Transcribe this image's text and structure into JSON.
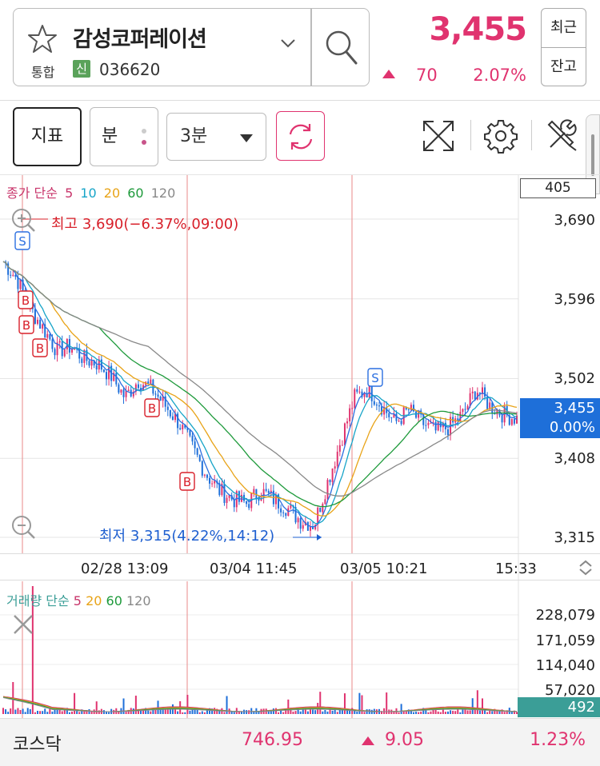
{
  "header": {
    "stock_name": "감성코퍼레이션",
    "market": "통합",
    "new_badge": "신",
    "code": "036620",
    "price": "3,455",
    "change": "70",
    "change_pct": "2.07%",
    "side_buttons": [
      "최근",
      "잔고"
    ]
  },
  "toolbar": {
    "indicator_label": "지표",
    "unit_label": "분",
    "interval_value": "3분",
    "icons": [
      "refresh-icon",
      "fullscreen-icon",
      "settings-icon",
      "tools-icon"
    ]
  },
  "price_chart": {
    "legend": {
      "prefix": "종가 단순",
      "ma": [
        "5",
        "10",
        "20",
        "60",
        "120"
      ]
    },
    "volume_box": "405",
    "y_axis": [
      "3,690",
      "3,596",
      "3,502",
      "3,408",
      "3,315"
    ],
    "current_price": "3,455",
    "current_pct": "0.00%",
    "high_label": "최고 3,690(−6.37%,09:00)",
    "low_label": "최저 3,315(4.22%,14:12)",
    "signals": [
      "S",
      "B",
      "B",
      "B",
      "B",
      "B",
      "S"
    ]
  },
  "time_axis": [
    "02/28 13:09",
    "03/04 11:45",
    "03/05 10:21",
    "15:33"
  ],
  "volume_chart": {
    "legend": {
      "prefix": "거래량 단순",
      "ma": [
        "5",
        "20",
        "60",
        "120"
      ]
    },
    "y_axis": [
      "228,079",
      "171,059",
      "114,040",
      "57,020"
    ],
    "current": "492"
  },
  "index_bar": {
    "name": "코스닥",
    "value": "746.95",
    "change": "9.05",
    "pct": "1.23%"
  },
  "colors": {
    "up": "#e0336f",
    "down": "#1e6fd9",
    "ma5": "#2b6fe0",
    "ma10": "#17a4c8",
    "ma20": "#e8a317",
    "ma60": "#1e9a3b",
    "ma120": "#888888"
  },
  "chart_data": {
    "type": "candlestick",
    "interval": "3분",
    "ylim": [
      3315,
      3690
    ],
    "high": 3690,
    "low": 3315,
    "last": 3455,
    "close_path": [
      3640,
      3620,
      3585,
      3560,
      3535,
      3540,
      3525,
      3520,
      3505,
      3480,
      3500,
      3490,
      3470,
      3450,
      3420,
      3390,
      3370,
      3360,
      3355,
      3370,
      3360,
      3350,
      3335,
      3330,
      3380,
      3430,
      3480,
      3490,
      3470,
      3450,
      3465,
      3450,
      3440,
      3445,
      3460,
      3490,
      3470,
      3460,
      3455
    ]
  }
}
